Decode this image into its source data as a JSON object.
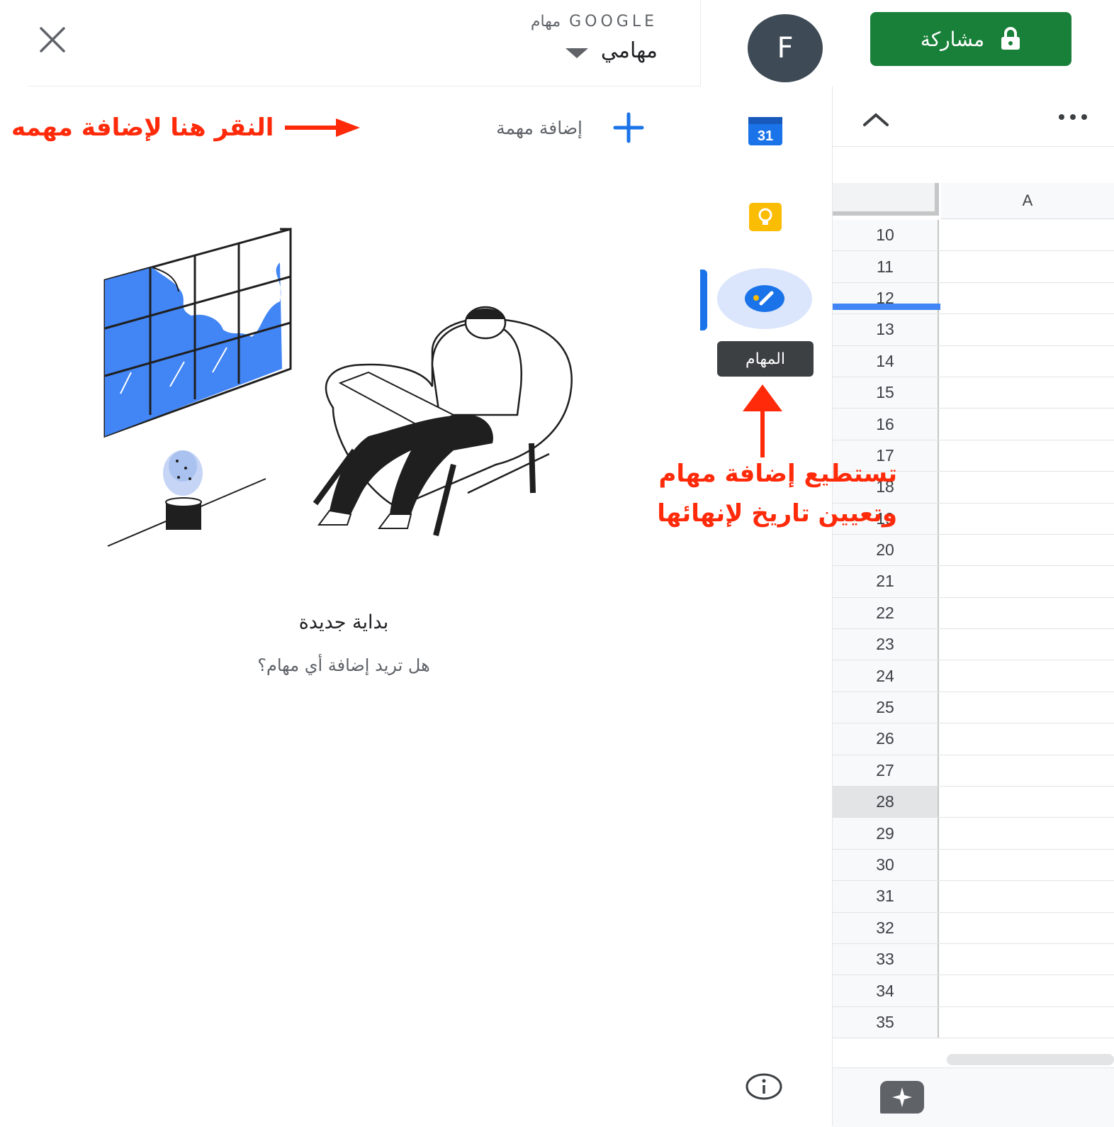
{
  "tasks_panel": {
    "app_name": "GOOGLE مهام",
    "list_name": "مهامي",
    "add_task_label": "إضافة مهمة",
    "empty_title": "بداية جديدة",
    "empty_subtitle": "هل تريد إضافة أي مهام؟",
    "icons": {
      "close": "close-icon",
      "caret": "caret-down-icon",
      "add": "plus-icon"
    }
  },
  "header": {
    "avatar_letter": "F",
    "share_label": "مشاركة",
    "share_icon": "lock-icon",
    "share_color": "#188038"
  },
  "side_rail": {
    "calendar_day": "31",
    "tooltip": "المهام",
    "icons": [
      "calendar-icon",
      "keep-icon",
      "tasks-icon",
      "info-icon"
    ]
  },
  "annotations": {
    "add_hint": "النقر هنا لإضافة مهمه",
    "dates_hint_line1": "تستطيع إضافة مهام",
    "dates_hint_line2": "وتعيين تاريخ لإنهائها",
    "color": "#ff2a0a"
  },
  "sheet": {
    "column_header": "A",
    "rows": [
      "10",
      "11",
      "12",
      "13",
      "14",
      "15",
      "16",
      "17",
      "18",
      "19",
      "20",
      "21",
      "22",
      "23",
      "24",
      "25",
      "26",
      "27",
      "28",
      "29",
      "30",
      "31",
      "32",
      "33",
      "34",
      "35"
    ],
    "selected_row": "28"
  }
}
